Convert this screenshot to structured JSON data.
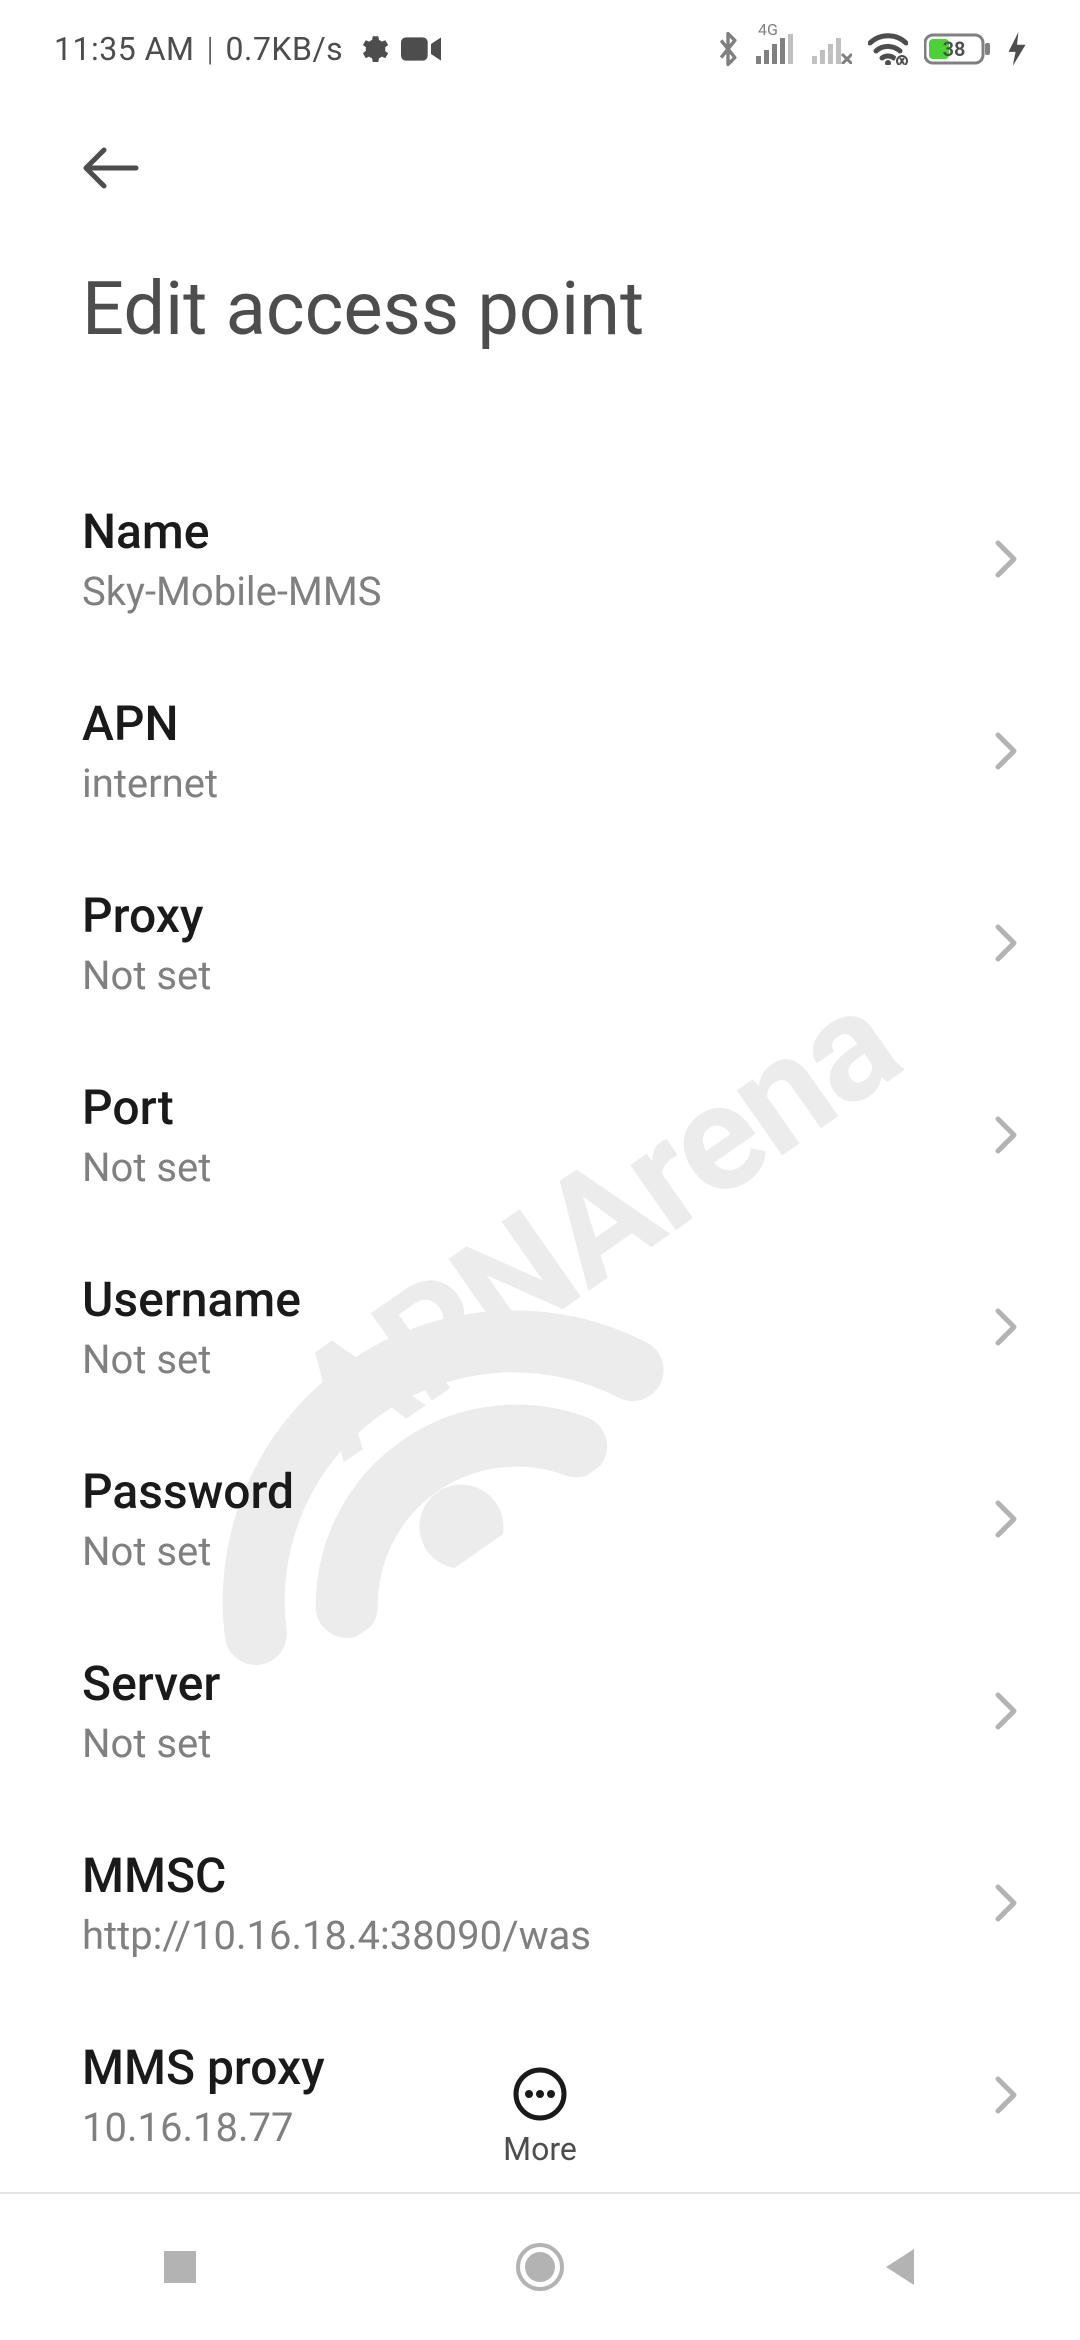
{
  "status": {
    "time": "11:35 AM",
    "netspeed": "0.7KB/s",
    "signal_tag": "4G",
    "battery": "38"
  },
  "header": {
    "title": "Edit access point"
  },
  "settings": [
    {
      "label": "Name",
      "value": "Sky-Mobile-MMS"
    },
    {
      "label": "APN",
      "value": "internet"
    },
    {
      "label": "Proxy",
      "value": "Not set"
    },
    {
      "label": "Port",
      "value": "Not set"
    },
    {
      "label": "Username",
      "value": "Not set"
    },
    {
      "label": "Password",
      "value": "Not set"
    },
    {
      "label": "Server",
      "value": "Not set"
    },
    {
      "label": "MMSC",
      "value": "http://10.16.18.4:38090/was"
    },
    {
      "label": "MMS proxy",
      "value": "10.16.18.77"
    }
  ],
  "footer": {
    "more_label": "More"
  },
  "watermark": "APNArena"
}
